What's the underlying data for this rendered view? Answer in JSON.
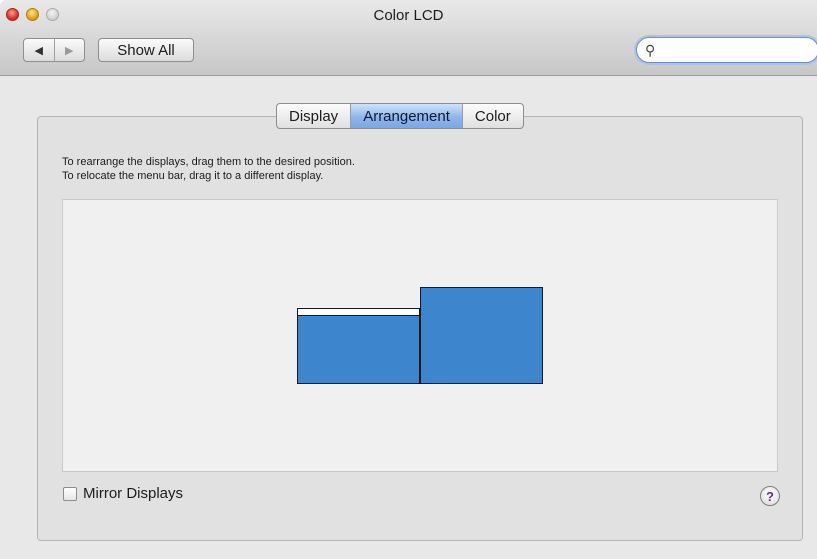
{
  "window": {
    "title": "Color LCD"
  },
  "toolbar": {
    "back_glyph": "◀",
    "forward_glyph": "▶",
    "show_all_label": "Show All",
    "search_icon_glyph": "🔍",
    "search_value": "",
    "search_placeholder": ""
  },
  "tabs": [
    {
      "label": "Display",
      "active": false
    },
    {
      "label": "Arrangement",
      "active": true
    },
    {
      "label": "Color",
      "active": false
    }
  ],
  "instructions": {
    "line1": "To rearrange the displays, drag them to the desired position.",
    "line2": "To relocate the menu bar, drag it to a different display."
  },
  "displays": [
    {
      "name": "display-1",
      "has_menu_bar": true
    },
    {
      "name": "display-2",
      "has_menu_bar": false
    }
  ],
  "mirror": {
    "label": "Mirror Displays",
    "checked": false
  },
  "help": {
    "glyph": "?"
  },
  "colors": {
    "display_fill": "#3d86ce",
    "active_tab": "#8fb6ea",
    "help_glyph": "#5b2aa6"
  }
}
